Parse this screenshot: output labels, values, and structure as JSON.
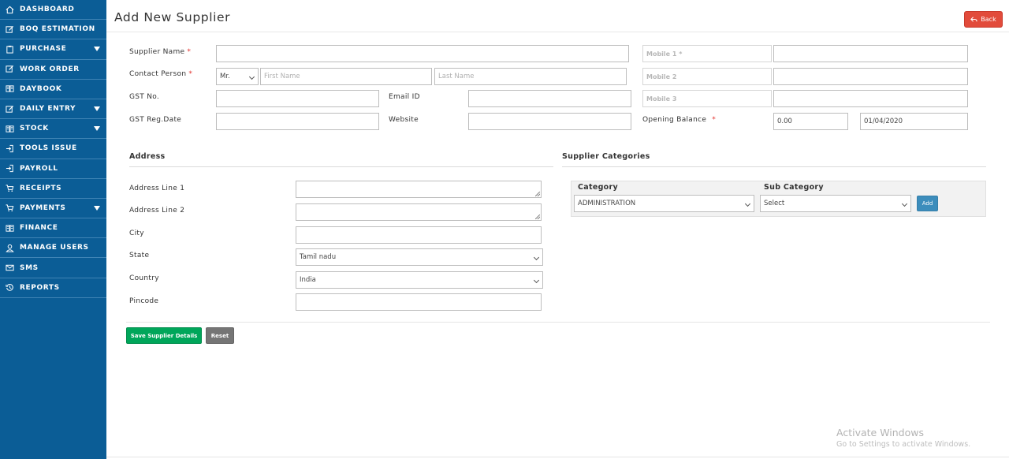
{
  "sidebar": {
    "items": [
      {
        "label": "DASHBOARD",
        "icon": "home-icon",
        "dropdown": false
      },
      {
        "label": "BOQ ESTIMATION",
        "icon": "edit-icon",
        "dropdown": false
      },
      {
        "label": "PURCHASE",
        "icon": "clipboard-icon",
        "dropdown": true
      },
      {
        "label": "WORK ORDER",
        "icon": "edit-icon",
        "dropdown": false
      },
      {
        "label": "DAYBOOK",
        "icon": "book-icon",
        "dropdown": false
      },
      {
        "label": "DAILY ENTRY",
        "icon": "edit-icon",
        "dropdown": true
      },
      {
        "label": "STOCK",
        "icon": "book-icon",
        "dropdown": true
      },
      {
        "label": "TOOLS ISSUE",
        "icon": "sign-in-icon",
        "dropdown": false
      },
      {
        "label": "PAYROLL",
        "icon": "sign-in-icon",
        "dropdown": false
      },
      {
        "label": "RECEIPTS",
        "icon": "cart-icon",
        "dropdown": false
      },
      {
        "label": "PAYMENTS",
        "icon": "cart-icon",
        "dropdown": true
      },
      {
        "label": "FINANCE",
        "icon": "book-icon",
        "dropdown": false
      },
      {
        "label": "MANAGE USERS",
        "icon": "user-icon",
        "dropdown": false
      },
      {
        "label": "SMS",
        "icon": "envelope-icon",
        "dropdown": false
      },
      {
        "label": "REPORTS",
        "icon": "history-icon",
        "dropdown": false
      }
    ]
  },
  "header": {
    "title": "Add New Supplier",
    "back_label": "Back"
  },
  "form": {
    "supplier_name_label": "Supplier Name",
    "contact_person_label": "Contact Person",
    "gst_no_label": "GST No.",
    "gst_reg_date_label": "GST Reg.Date",
    "email_label": "Email ID",
    "website_label": "Website",
    "opening_balance_label": "Opening Balance",
    "required_mark": "*",
    "salutation_value": "Mr.",
    "first_name_placeholder": "First Name",
    "last_name_placeholder": "Last Name",
    "mobile1_placeholder": "Mobile 1 *",
    "mobile2_placeholder": "Mobile 2",
    "mobile3_placeholder": "Mobile 3",
    "opening_balance_value": "0.00",
    "opening_balance_date": "01/04/2020"
  },
  "address": {
    "heading": "Address",
    "line1_label": "Address Line 1",
    "line2_label": "Address Line 2",
    "city_label": "City",
    "state_label": "State",
    "state_value": "Tamil nadu",
    "country_label": "Country",
    "country_value": "India",
    "pincode_label": "Pincode"
  },
  "categories": {
    "heading": "Supplier Categories",
    "category_header": "Category",
    "subcategory_header": "Sub Category",
    "category_value": "ADMINISTRATION",
    "subcategory_value": "Select",
    "add_label": "Add"
  },
  "actions": {
    "save_label": "Save Supplier Details",
    "reset_label": "Reset"
  },
  "watermark": {
    "title": "Activate Windows",
    "subtitle": "Go to Settings to activate Windows."
  }
}
